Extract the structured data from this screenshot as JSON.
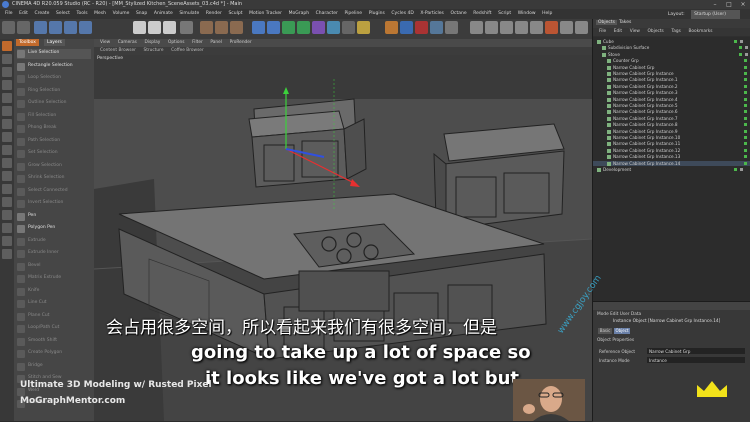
{
  "window": {
    "title": "CINEMA 4D R20.059 Studio (RC - R20) - [MM_Stylized Kitchen_SceneAssets_03.c4d *] - Main"
  },
  "menubar": {
    "items": [
      "File",
      "Edit",
      "Create",
      "Select",
      "Tools",
      "Mesh",
      "Volume",
      "Snap",
      "Animate",
      "Simulate",
      "Render",
      "Sculpt",
      "Motion Tracker",
      "MoGraph",
      "Character",
      "Pipeline",
      "Plugins",
      "Cycles 4D",
      "X-Particles",
      "Octane",
      "Redshift",
      "Script",
      "Window",
      "Help"
    ],
    "layout_label": "Layout:",
    "layout_value": "Startup (User)"
  },
  "toolpanel": {
    "tabs": [
      "Toolbox",
      "Layers"
    ],
    "items": [
      {
        "label": "Live Selection",
        "active": true
      },
      {
        "label": "Rectangle Selection",
        "active": true
      },
      {
        "label": "Loop Selection",
        "active": false
      },
      {
        "label": "Ring Selection",
        "active": false
      },
      {
        "label": "Outline Selection",
        "active": false
      },
      {
        "label": "Fill Selection",
        "active": false
      },
      {
        "label": "Phong Break",
        "active": false
      },
      {
        "label": "Path Selection",
        "active": false
      },
      {
        "label": "Set Selection",
        "active": false
      },
      {
        "label": "Grow Selection",
        "active": false
      },
      {
        "label": "Shrink Selection",
        "active": false
      },
      {
        "label": "Select Connected",
        "active": false
      },
      {
        "label": "Invert Selection",
        "active": false
      },
      {
        "label": "Pen",
        "active": true
      },
      {
        "label": "Polygon Pen",
        "active": true
      },
      {
        "label": "Extrude",
        "active": false
      },
      {
        "label": "Extrude Inner",
        "active": false
      },
      {
        "label": "Bevel",
        "active": false
      },
      {
        "label": "Matrix Extrude",
        "active": false
      },
      {
        "label": "Knife",
        "active": false
      },
      {
        "label": "Line Cut",
        "active": false
      },
      {
        "label": "Plane Cut",
        "active": false
      },
      {
        "label": "Loop/Path Cut",
        "active": false
      },
      {
        "label": "Smooth Shift",
        "active": false
      },
      {
        "label": "Create Polygon",
        "active": false
      },
      {
        "label": "Bridge",
        "active": false
      },
      {
        "label": "Stitch and Sew",
        "active": false
      },
      {
        "label": "Weld",
        "active": false
      },
      {
        "label": "Dissolve",
        "active": false
      }
    ]
  },
  "viewport": {
    "menu": [
      "View",
      "Cameras",
      "Display",
      "Options",
      "Filter",
      "Panel",
      "ProRender"
    ],
    "tabs": [
      "Content Browser",
      "Structure",
      "Coffee Browser"
    ],
    "label": "Perspective"
  },
  "rightpanel": {
    "tabs": [
      "Objects",
      "Takes"
    ],
    "menu": [
      "File",
      "Edit",
      "View",
      "Objects",
      "Tags",
      "Bookmarks"
    ],
    "outliner_rows": [
      {
        "label": "Cube",
        "indent": 0,
        "hl": false
      },
      {
        "label": "Subdivision Surface",
        "indent": 1,
        "hl": false
      },
      {
        "label": "Stove",
        "indent": 1,
        "hl": false
      },
      {
        "label": "Counter Grp",
        "indent": 2,
        "hl": false
      },
      {
        "label": "Narrow Cabinet Grp",
        "indent": 2,
        "hl": false
      },
      {
        "label": "Narrow Cabinet Grp Instance",
        "indent": 2,
        "hl": false
      },
      {
        "label": "Narrow Cabinet Grp Instance.1",
        "indent": 2,
        "hl": false
      },
      {
        "label": "Narrow Cabinet Grp Instance.2",
        "indent": 2,
        "hl": false
      },
      {
        "label": "Narrow Cabinet Grp Instance.3",
        "indent": 2,
        "hl": false
      },
      {
        "label": "Narrow Cabinet Grp Instance.4",
        "indent": 2,
        "hl": false
      },
      {
        "label": "Narrow Cabinet Grp Instance.5",
        "indent": 2,
        "hl": false
      },
      {
        "label": "Narrow Cabinet Grp Instance.6",
        "indent": 2,
        "hl": false
      },
      {
        "label": "Narrow Cabinet Grp Instance.7",
        "indent": 2,
        "hl": false
      },
      {
        "label": "Narrow Cabinet Grp Instance.8",
        "indent": 2,
        "hl": false
      },
      {
        "label": "Narrow Cabinet Grp Instance.9",
        "indent": 2,
        "hl": false
      },
      {
        "label": "Narrow Cabinet Grp Instance.10",
        "indent": 2,
        "hl": false
      },
      {
        "label": "Narrow Cabinet Grp Instance.11",
        "indent": 2,
        "hl": false
      },
      {
        "label": "Narrow Cabinet Grp Instance.12",
        "indent": 2,
        "hl": false
      },
      {
        "label": "Narrow Cabinet Grp Instance.13",
        "indent": 2,
        "hl": false
      },
      {
        "label": "Narrow Cabinet Grp Instance.14",
        "indent": 2,
        "hl": true
      },
      {
        "label": "Development",
        "indent": 0,
        "hl": false
      }
    ],
    "attr": {
      "mode_label": "Mode  Edit  User Data",
      "mode_name": "Instance Object [Narrow Cabinet Grp Instance.14]",
      "basic": "Basic",
      "object": "Object",
      "section": "Object Properties",
      "fields": [
        {
          "label": "Reference Object",
          "value": "Narrow Cabinet Grp"
        },
        {
          "label": "Instance Mode",
          "value": "Instance"
        }
      ]
    }
  },
  "overlay": {
    "subtitle_cn": "会占用很多空间，所以看起来我们有很多空间，但是",
    "subtitle_en_1": "going to take up a lot of space so",
    "subtitle_en_2": "it looks like we've got a lot but",
    "course_title": "Ultimate 3D Modeling w/ Rusted Pixel",
    "site": "MoGraphMentor.com",
    "watermark": "www.cgjoy.com"
  },
  "colors": {
    "accent": "#c26a2c",
    "selection": "#3e4a5a",
    "crown": "#f2e21a",
    "bg": "#3a3a3a"
  }
}
